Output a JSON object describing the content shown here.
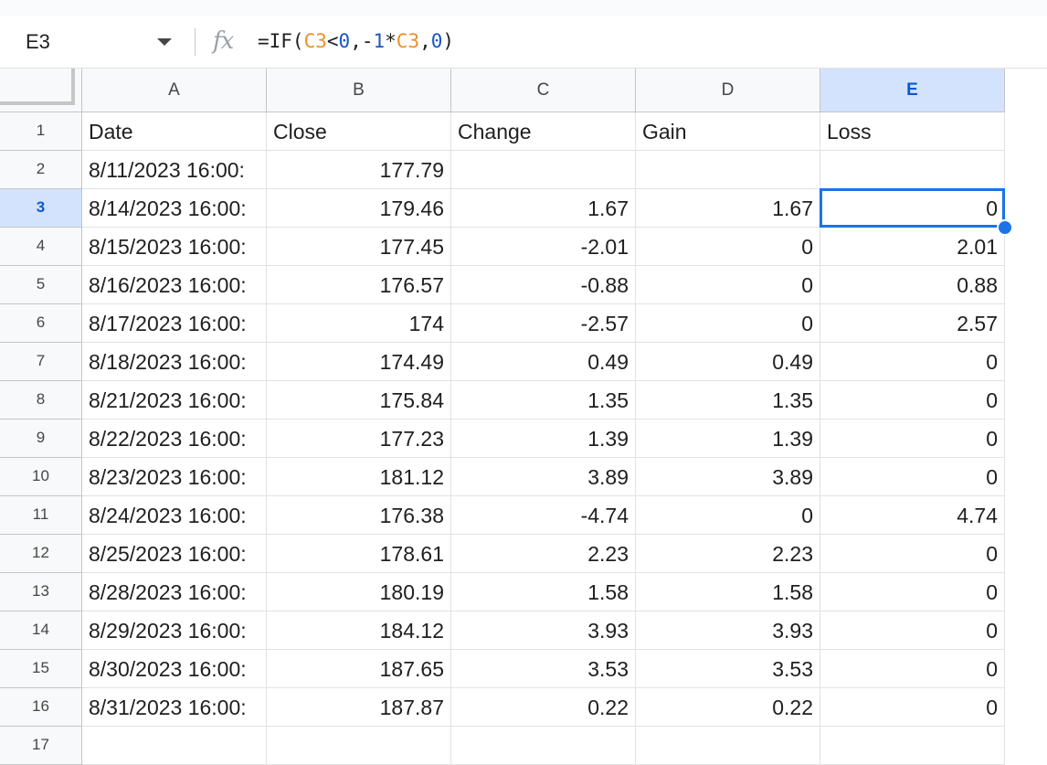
{
  "name_box": "E3",
  "formula_bar": {
    "icon": "fx-icon",
    "tokens": [
      {
        "text": "=IF(",
        "kind": "plain"
      },
      {
        "text": "C3",
        "kind": "ref"
      },
      {
        "text": "<",
        "kind": "plain"
      },
      {
        "text": "0",
        "kind": "num"
      },
      {
        "text": ",-",
        "kind": "plain"
      },
      {
        "text": "1",
        "kind": "num"
      },
      {
        "text": "*",
        "kind": "plain"
      },
      {
        "text": "C3",
        "kind": "ref"
      },
      {
        "text": ",",
        "kind": "plain"
      },
      {
        "text": "0",
        "kind": "num"
      },
      {
        "text": ")",
        "kind": "plain"
      }
    ]
  },
  "columns": [
    "A",
    "B",
    "C",
    "D",
    "E"
  ],
  "selected": {
    "column": "E",
    "row": "3"
  },
  "rows": [
    {
      "n": "1",
      "cells": [
        "Date",
        "Close",
        "Change",
        "Gain",
        "Loss"
      ]
    },
    {
      "n": "2",
      "cells": [
        "8/11/2023 16:00:",
        "177.79",
        "",
        "",
        ""
      ]
    },
    {
      "n": "3",
      "cells": [
        "8/14/2023 16:00:",
        "179.46",
        "1.67",
        "1.67",
        "0"
      ]
    },
    {
      "n": "4",
      "cells": [
        "8/15/2023 16:00:",
        "177.45",
        "-2.01",
        "0",
        "2.01"
      ]
    },
    {
      "n": "5",
      "cells": [
        "8/16/2023 16:00:",
        "176.57",
        "-0.88",
        "0",
        "0.88"
      ]
    },
    {
      "n": "6",
      "cells": [
        "8/17/2023 16:00:",
        "174",
        "-2.57",
        "0",
        "2.57"
      ]
    },
    {
      "n": "7",
      "cells": [
        "8/18/2023 16:00:",
        "174.49",
        "0.49",
        "0.49",
        "0"
      ]
    },
    {
      "n": "8",
      "cells": [
        "8/21/2023 16:00:",
        "175.84",
        "1.35",
        "1.35",
        "0"
      ]
    },
    {
      "n": "9",
      "cells": [
        "8/22/2023 16:00:",
        "177.23",
        "1.39",
        "1.39",
        "0"
      ]
    },
    {
      "n": "10",
      "cells": [
        "8/23/2023 16:00:",
        "181.12",
        "3.89",
        "3.89",
        "0"
      ]
    },
    {
      "n": "11",
      "cells": [
        "8/24/2023 16:00:",
        "176.38",
        "-4.74",
        "0",
        "4.74"
      ]
    },
    {
      "n": "12",
      "cells": [
        "8/25/2023 16:00:",
        "178.61",
        "2.23",
        "2.23",
        "0"
      ]
    },
    {
      "n": "13",
      "cells": [
        "8/28/2023 16:00:",
        "180.19",
        "1.58",
        "1.58",
        "0"
      ]
    },
    {
      "n": "14",
      "cells": [
        "8/29/2023 16:00:",
        "184.12",
        "3.93",
        "3.93",
        "0"
      ]
    },
    {
      "n": "15",
      "cells": [
        "8/30/2023 16:00:",
        "187.65",
        "3.53",
        "3.53",
        "0"
      ]
    },
    {
      "n": "16",
      "cells": [
        "8/31/2023 16:00:",
        "187.87",
        "0.22",
        "0.22",
        "0"
      ]
    },
    {
      "n": "17",
      "cells": [
        "",
        "",
        "",
        "",
        ""
      ]
    }
  ],
  "colors": {
    "selection": "#1a73e8",
    "header_selected": "#d3e3fd",
    "ref_token": "#e8912d",
    "num_token": "#1a56c4"
  }
}
